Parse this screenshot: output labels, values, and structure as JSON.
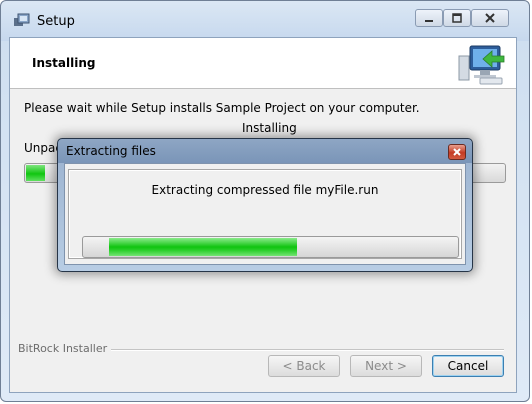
{
  "window": {
    "title": "Setup"
  },
  "header": {
    "title": "Installing"
  },
  "body": {
    "description": "Please wait while Setup installs Sample Project on your computer.",
    "status": "Installing",
    "unpack_label": "Unpack",
    "progress_fraction": 0.04
  },
  "footer": {
    "brand": "BitRock Installer",
    "back_label": "< Back",
    "next_label": "Next >",
    "cancel_label": "Cancel"
  },
  "dialog": {
    "title": "Extracting files",
    "message": "Extracting compressed file myFile.run",
    "progress_start_fraction": 0.07,
    "progress_fraction": 0.57
  },
  "colors": {
    "progress_green": "#11c611",
    "close_red": "#c43b24"
  },
  "icons": [
    "setup-app-icon",
    "minimize-icon",
    "maximize-icon",
    "close-icon",
    "installer-computer-icon",
    "dialog-close-icon"
  ]
}
